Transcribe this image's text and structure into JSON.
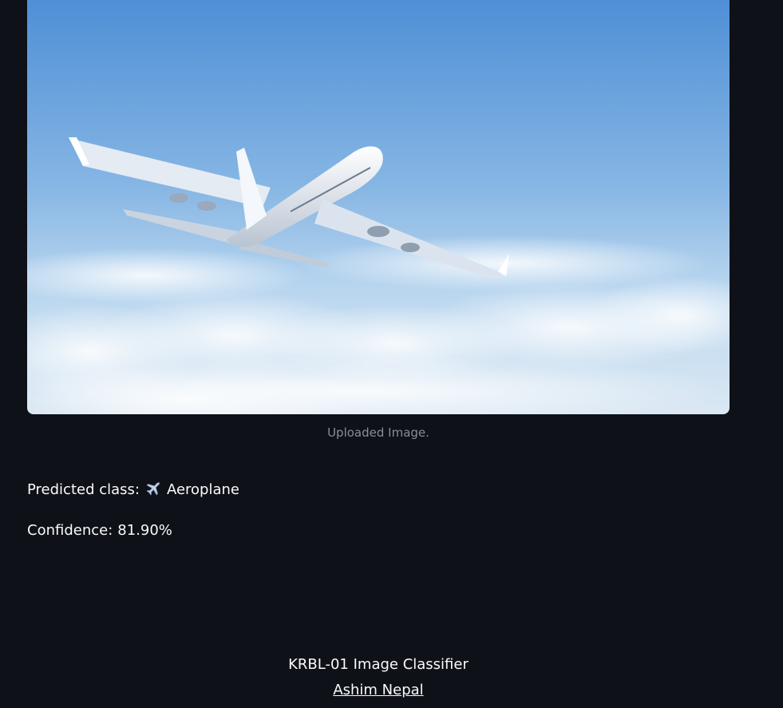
{
  "uploaded_image": {
    "caption": "Uploaded Image."
  },
  "result": {
    "predicted_label": "Predicted class:",
    "predicted_icon": "airplane-icon",
    "predicted_value": "Aeroplane",
    "confidence_label": "Confidence:",
    "confidence_value": "81.90%"
  },
  "footer": {
    "title": "KRBL-01 Image Classifier",
    "author_link": "Ashim Nepal"
  },
  "colors": {
    "background": "#0e1117",
    "text": "#fafafa",
    "caption": "#8b8d94"
  }
}
